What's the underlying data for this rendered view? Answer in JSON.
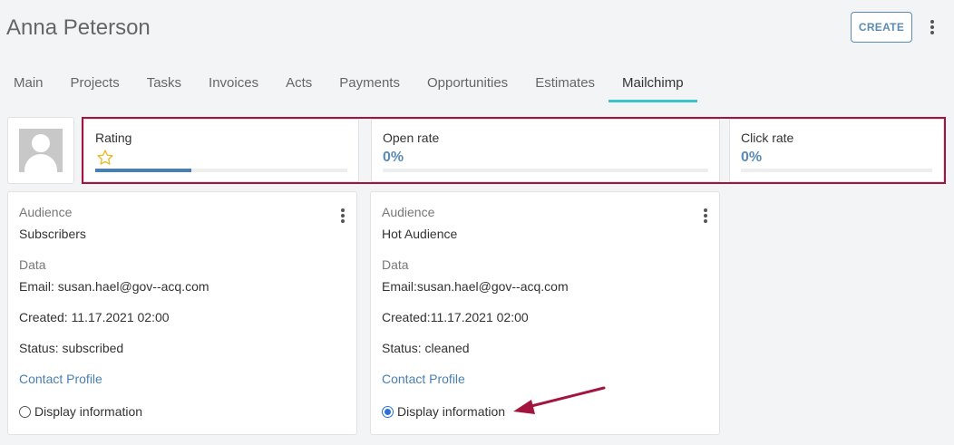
{
  "header": {
    "title": "Anna Peterson",
    "create_label": "CREATE",
    "menu_icon": "more-vertical-icon"
  },
  "tabs": [
    {
      "label": "Main",
      "active": false
    },
    {
      "label": "Projects",
      "active": false
    },
    {
      "label": "Tasks",
      "active": false
    },
    {
      "label": "Invoices",
      "active": false
    },
    {
      "label": "Acts",
      "active": false
    },
    {
      "label": "Payments",
      "active": false
    },
    {
      "label": "Opportunities",
      "active": false
    },
    {
      "label": "Estimates",
      "active": false
    },
    {
      "label": "Mailchimp",
      "active": true
    }
  ],
  "stats": {
    "rating": {
      "label": "Rating",
      "icon": "star-outline-icon",
      "progress": 0.38
    },
    "open_rate": {
      "label": "Open rate",
      "value": "0%",
      "progress": 0
    },
    "click_rate": {
      "label": "Click rate",
      "value": "0%",
      "progress": 0
    }
  },
  "audiences": [
    {
      "audience_label": "Audience",
      "audience_name": "Subscribers",
      "data_label": "Data",
      "email": "Email: susan.hael@gov--acq.com",
      "created": "Created: 11.17.2021 02:00",
      "status": "Status: subscribed",
      "contact_profile": "Contact Profile",
      "display_info": "Display information",
      "display_checked": false
    },
    {
      "audience_label": "Audience",
      "audience_name": "Hot Audience",
      "data_label": "Data",
      "email": "Email:susan.hael@gov--acq.com",
      "created": "Created:11.17.2021 02:00",
      "status": "Status: cleaned",
      "contact_profile": "Contact Profile",
      "display_info": "Display information",
      "display_checked": true
    }
  ],
  "colors": {
    "accent": "#4a7fb0",
    "tab_indicator": "#39c4cf",
    "highlight": "#a3153f",
    "star": "#e8b923"
  }
}
